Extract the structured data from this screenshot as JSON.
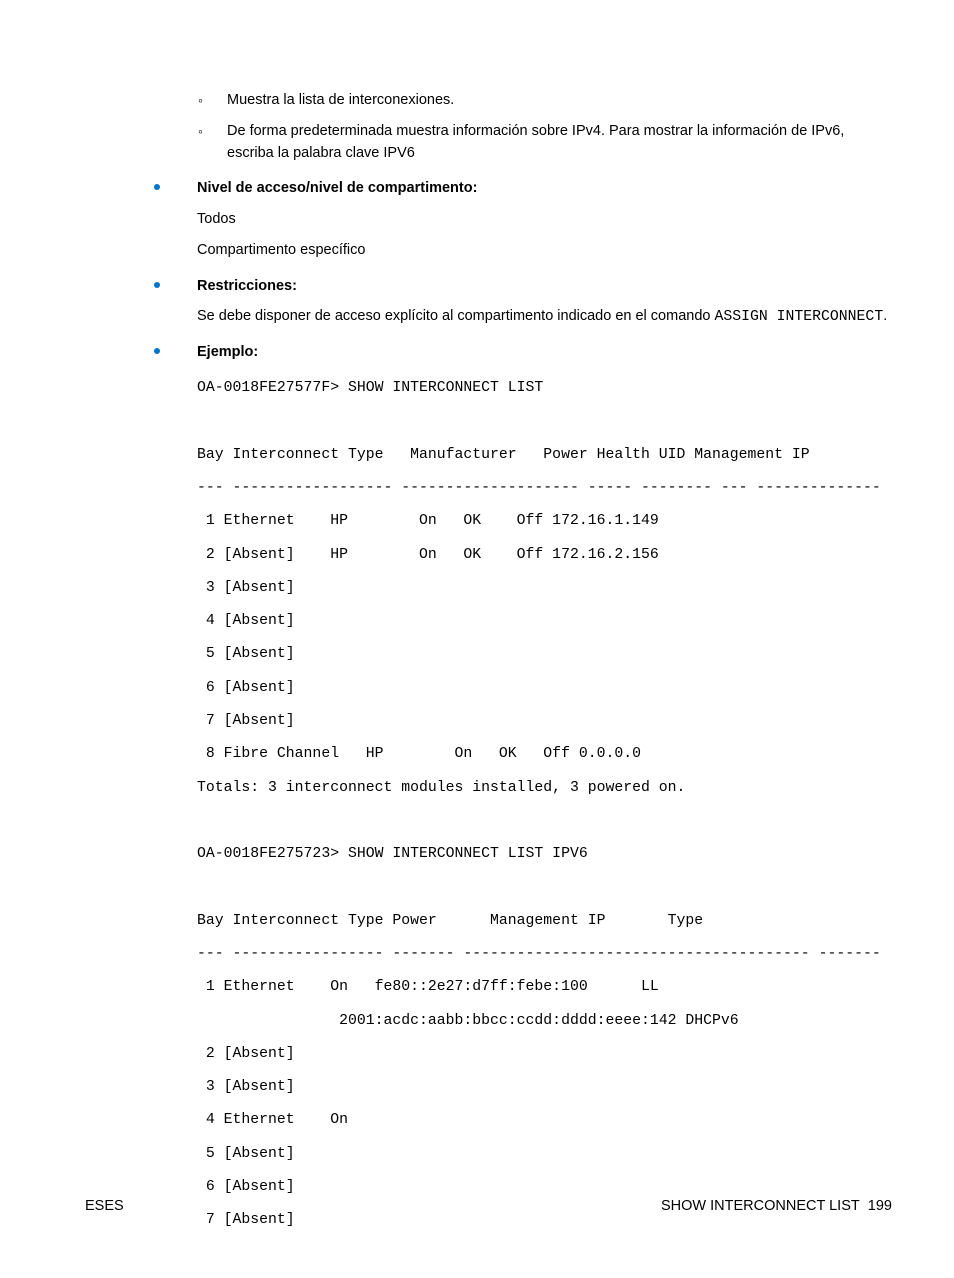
{
  "sub_items": [
    "Muestra la lista de interconexiones.",
    "De forma predeterminada muestra información sobre IPv4. Para mostrar la información de IPv6, escriba la palabra clave IPV6"
  ],
  "section_access": {
    "heading": "Nivel de acceso/nivel de compartimento:",
    "lines": [
      "Todos",
      "Compartimento específico"
    ]
  },
  "section_restrict": {
    "heading": "Restricciones:",
    "text_pre": "Se debe disponer de acceso explícito al compartimento indicado en el comando ",
    "code1": "ASSIGN INTERCONNECT",
    "text_post": "."
  },
  "section_example": {
    "heading": "Ejemplo:",
    "code": "OA-0018FE27577F> SHOW INTERCONNECT LIST\n\nBay Interconnect Type   Manufacturer   Power Health UID Management IP\n--- ------------------ -------------------- ----- -------- --- --------------\n 1 Ethernet    HP        On   OK    Off 172.16.1.149\n 2 [Absent]    HP        On   OK    Off 172.16.2.156\n 3 [Absent]\n 4 [Absent]\n 5 [Absent]\n 6 [Absent]\n 7 [Absent]\n 8 Fibre Channel   HP        On   OK   Off 0.0.0.0\nTotals: 3 interconnect modules installed, 3 powered on.\n\nOA-0018FE275723> SHOW INTERCONNECT LIST IPV6\n\nBay Interconnect Type Power      Management IP       Type\n--- ----------------- ------- --------------------------------------- -------\n 1 Ethernet    On   fe80::2e27:d7ff:febe:100      LL\n                2001:acdc:aabb:bbcc:ccdd:dddd:eeee:142 DHCPv6\n 2 [Absent]\n 3 [Absent]\n 4 Ethernet    On\n 5 [Absent]\n 6 [Absent]\n 7 [Absent]"
  },
  "footer": {
    "left": "ESES",
    "right_label": "SHOW INTERCONNECT LIST",
    "page": "199"
  }
}
